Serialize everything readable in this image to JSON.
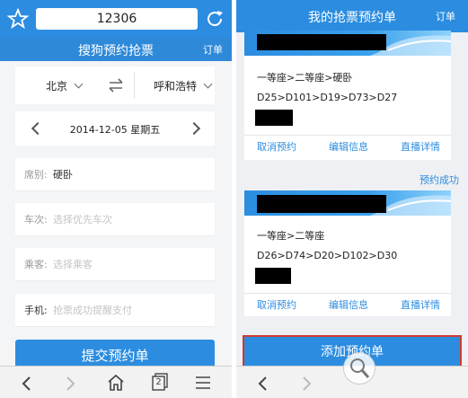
{
  "left": {
    "address": "12306",
    "title": "搜狗预约抢票",
    "title_right": "订单",
    "from_station": "北京",
    "to_station": "呼和浩特",
    "date": "2014-12-05 星期五",
    "fields": [
      {
        "label": "席别:",
        "value": "硬卧"
      },
      {
        "label": "车次:",
        "placeholder": "选择优先车次"
      },
      {
        "label": "乘客:",
        "placeholder": "选择乘客"
      },
      {
        "label": "手机:",
        "placeholder": "抢票成功提醒支付"
      }
    ],
    "submit_label": "提交预约单",
    "tab_count": "2"
  },
  "right": {
    "title": "我的抢票预约单",
    "title_right": "订单",
    "orders": [
      {
        "seats": "一等座>二等座>硬卧",
        "trains": "D25>D101>D19>D73>D27",
        "actions": [
          "取消预约",
          "编辑信息",
          "直播详情"
        ]
      },
      {
        "status": "预约成功",
        "seats": "一等座>二等座",
        "trains": "D26>D74>D20>D102>D30",
        "actions": [
          "取消预约",
          "编辑信息",
          "直播详情"
        ]
      }
    ],
    "add_label": "添加预约单"
  },
  "colors": {
    "primary": "#2c8de0",
    "highlight_border": "#d23a2f"
  }
}
